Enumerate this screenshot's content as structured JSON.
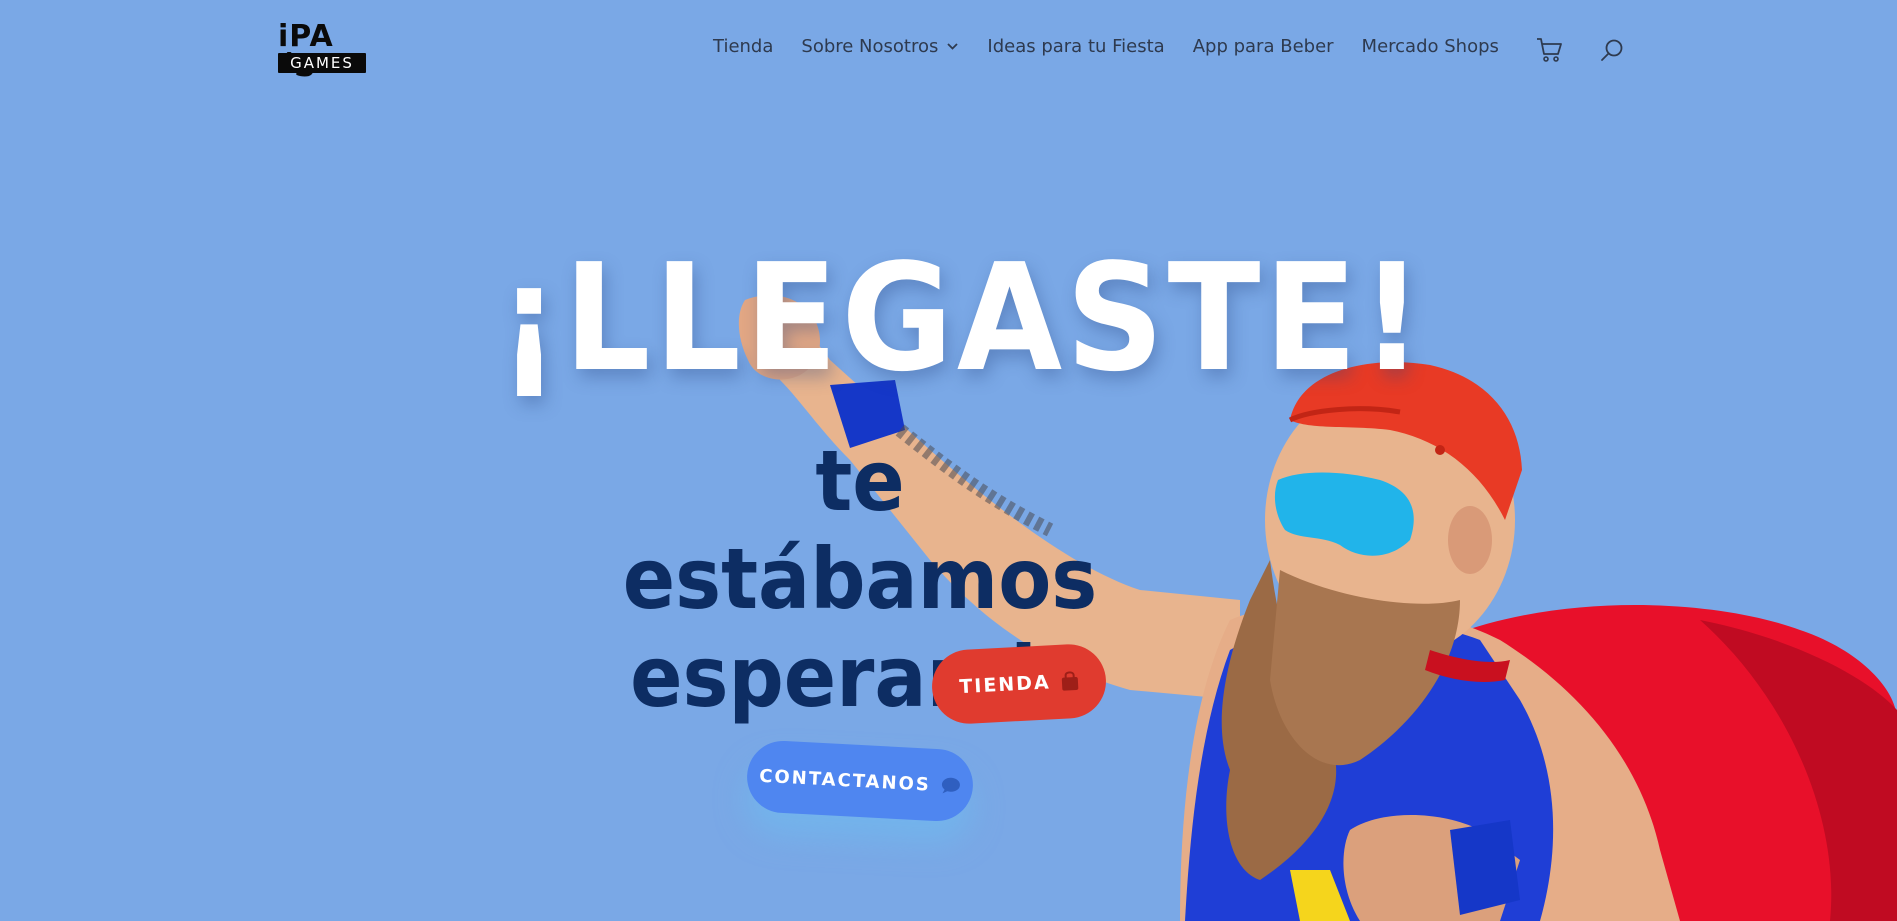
{
  "brand": {
    "logo_top": "iPA´S",
    "logo_bottom": "GAMES"
  },
  "nav": {
    "items": [
      {
        "label": "Tienda"
      },
      {
        "label": "Sobre Nosotros",
        "has_dropdown": true
      },
      {
        "label": "Ideas para tu Fiesta"
      },
      {
        "label": "App para Beber"
      },
      {
        "label": "Mercado Shops"
      }
    ],
    "icons": [
      "cart-icon",
      "search-icon"
    ]
  },
  "hero": {
    "title": "¡LLEGASTE!",
    "subtitle_line1": "te estábamos",
    "subtitle_line2": "esperando"
  },
  "buttons": {
    "tienda_label": "TIENDA",
    "tienda_icon": "shopping-bag-icon",
    "contact_label": "CONTACTANOS",
    "contact_icon": "chat-bubble-icon"
  },
  "colors": {
    "background": "#7aa8e6",
    "title": "#ffffff",
    "subtitle": "#0d2d63",
    "tienda_button": "#e03b2f",
    "contact_button": "#4f86f0",
    "nav_text": "#2e3a4f"
  }
}
